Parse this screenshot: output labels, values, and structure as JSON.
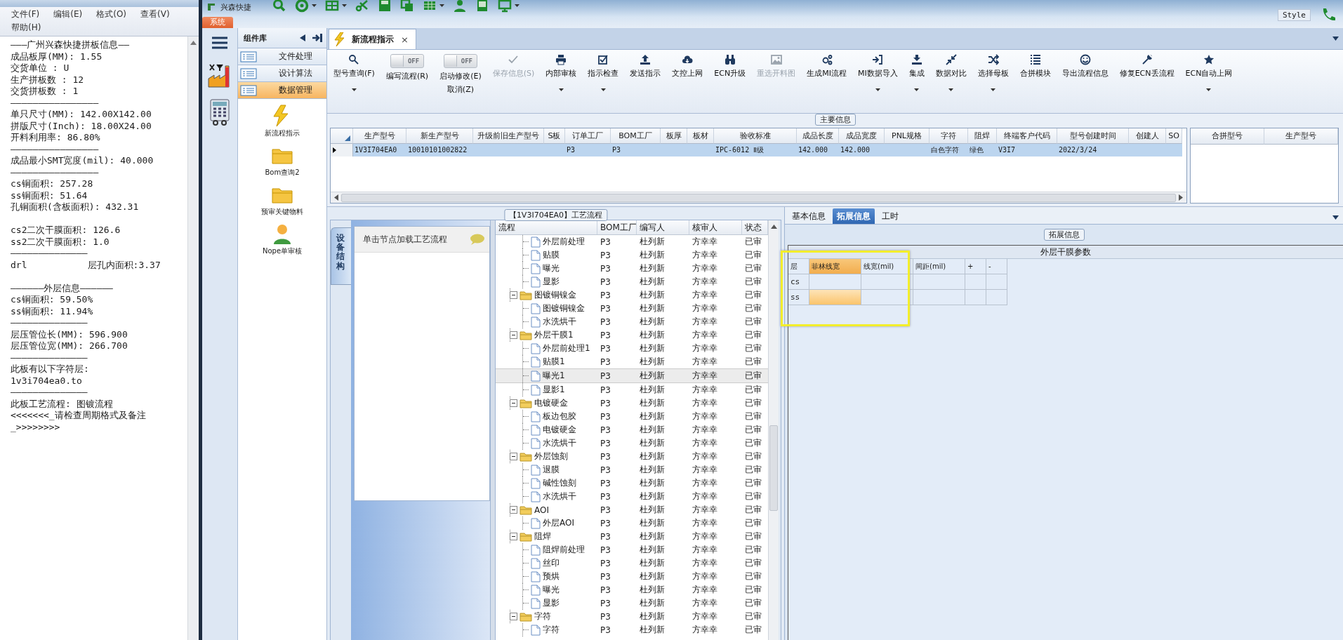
{
  "notepad": {
    "menu": [
      "文件(F)",
      "编辑(E)",
      "格式(O)",
      "查看(V)",
      "帮助(H)"
    ],
    "lines": [
      {
        "text": "———广州兴森快捷拼板信息——"
      },
      {
        "text": "成品板厚(MM): 1.55"
      },
      {
        "text": "交货单位 : U"
      },
      {
        "text": "生产拼板数 : 12"
      },
      {
        "text": "交货拼板数 : 1"
      },
      {
        "text": "————————————————"
      },
      {
        "text": "单只尺寸(MM): 142.00X142.00"
      },
      {
        "text": "拼版尺寸(Inch): 18.00X24.00"
      },
      {
        "text": "开料利用率: 86.80%"
      },
      {
        "text": "————————————————"
      },
      {
        "text": "成品最小SMT宽度(mil): 40.000"
      },
      {
        "text": "————————————————"
      },
      {
        "text": "cs铜面积: 257.28"
      },
      {
        "text": "ss铜面积: 51.64"
      },
      {
        "text": "孔铜面积(含板面积): 432.31"
      },
      {
        "kind": "blank"
      },
      {
        "text": "cs2二次干膜面积: 126.6"
      },
      {
        "text": "ss2二次干膜面积: 1.0"
      },
      {
        "text": "——————————————"
      },
      {
        "text": "drl           层孔内面积:3.37"
      },
      {
        "kind": "blank"
      },
      {
        "text": "——————外层信息——————"
      },
      {
        "text": "cs铜面积: 59.50%"
      },
      {
        "text": "ss铜面积: 11.94%"
      },
      {
        "text": "——————————————"
      },
      {
        "text": "层压管位长(MM): 596.900"
      },
      {
        "text": "层压管位宽(MM): 266.700"
      },
      {
        "text": "——————————————"
      },
      {
        "text": "此板有以下字符层:"
      },
      {
        "text": "1v3i704ea0.to"
      },
      {
        "text": "——————————————"
      },
      {
        "text": "此板工艺流程: 图镀流程"
      },
      {
        "text": "<<<<<<<_请检查周期格式及备注"
      },
      {
        "text": "_>>>>>>>>"
      }
    ]
  },
  "app": {
    "title": "兴森快捷",
    "system_tab": "系统",
    "style_label": "Style"
  },
  "component_library": {
    "title": "组件库",
    "categories": [
      {
        "label": "文件处理",
        "selected": false
      },
      {
        "label": "设计算法",
        "selected": false
      },
      {
        "label": "数据管理",
        "selected": true
      }
    ],
    "items": [
      {
        "label": "新流程指示"
      },
      {
        "label": "Bom查询2"
      },
      {
        "label": "预审关键物料"
      },
      {
        "label": "Nope单审核"
      }
    ]
  },
  "document_tabs": [
    {
      "label": "新流程指示",
      "close": "×",
      "selected": true
    }
  ],
  "ribbon": [
    {
      "kind": "button",
      "label": "型号查询(F)",
      "dropdown": true,
      "disabled": false
    },
    {
      "kind": "toggle",
      "toggle_text": "OFF",
      "on": false,
      "label": "编写流程(R)",
      "dropdown": false,
      "disabled": false
    },
    {
      "kind": "toggle",
      "toggle_text": "OFF",
      "on": false,
      "label": "启动修改(E)",
      "label2": "取消(Z)",
      "dropdown": false,
      "disabled": false
    },
    {
      "kind": "button",
      "label": "保存信息(S)",
      "dropdown": false,
      "disabled": true
    },
    {
      "kind": "button",
      "label": "内部审核",
      "dropdown": true,
      "disabled": false
    },
    {
      "kind": "button",
      "label": "指示检查",
      "dropdown": true,
      "disabled": false
    },
    {
      "kind": "button",
      "label": "发送指示",
      "dropdown": false,
      "disabled": false
    },
    {
      "kind": "button",
      "label": "文控上网",
      "dropdown": false,
      "disabled": false
    },
    {
      "kind": "button",
      "label": "ECN升级",
      "dropdown": false,
      "disabled": false
    },
    {
      "kind": "button",
      "label": "重选开料图",
      "dropdown": false,
      "disabled": true
    },
    {
      "kind": "button",
      "label": "生成MI流程",
      "dropdown": false,
      "disabled": false
    },
    {
      "kind": "button",
      "label": "MI数据导入",
      "dropdown": true,
      "disabled": false
    },
    {
      "kind": "button",
      "label": "集成",
      "dropdown": true,
      "disabled": false
    },
    {
      "kind": "button",
      "label": "数据对比",
      "dropdown": true,
      "disabled": false
    },
    {
      "kind": "button",
      "label": "选择母板",
      "dropdown": true,
      "disabled": false
    },
    {
      "kind": "button",
      "label": "合拼模块",
      "dropdown": false,
      "disabled": false
    },
    {
      "kind": "button",
      "label": "导出流程信息",
      "dropdown": false,
      "disabled": false
    },
    {
      "kind": "button",
      "label": "修复ECN丢流程",
      "dropdown": false,
      "disabled": false
    },
    {
      "kind": "button",
      "label": "ECN自动上网",
      "dropdown": true,
      "disabled": false
    }
  ],
  "main_info": {
    "title": "主要信息",
    "columns": [
      "生产型号",
      "新生产型号",
      "升级前旧生产型号",
      "S板",
      "订单工厂",
      "BOM工厂",
      "板厚",
      "板材",
      "验收标准",
      "成品长度",
      "成品宽度",
      "PNL规格",
      "字符",
      "阻焊",
      "终端客户代码",
      "型号创建时间",
      "创建人",
      "SO"
    ],
    "rows": [
      {
        "selected": true,
        "cells": [
          "1V3I704EA0",
          "10010101002822",
          null,
          null,
          "P3",
          "P3",
          null,
          null,
          "IPC-6012 Ⅱ级",
          "142.000",
          "142.000",
          null,
          "白色字符",
          "绿色",
          "V3I7",
          "2022/3/24",
          null,
          null
        ]
      }
    ],
    "side_columns": [
      "合拼型号",
      "生产型号"
    ]
  },
  "process_flow": {
    "title": "【1V3I704EA0】工艺流程",
    "side_tab": "设备结构",
    "hint": "单击节点加载工艺流程",
    "columns": [
      "流程",
      "BOM工厂",
      "编写人",
      "核审人",
      "状态"
    ],
    "tree": [
      {
        "kind": "continued",
        "children": [
          {
            "kind": "step",
            "label": "外层前处理",
            "bom": "P3",
            "writer": "杜列新",
            "reviewer": "方幸幸",
            "status": "已审",
            "selected": false
          },
          {
            "kind": "step",
            "label": "贴膜",
            "bom": "P3",
            "writer": "杜列新",
            "reviewer": "方幸幸",
            "status": "已审",
            "selected": false
          },
          {
            "kind": "step",
            "label": "曝光",
            "bom": "P3",
            "writer": "杜列新",
            "reviewer": "方幸幸",
            "status": "已审",
            "selected": false
          },
          {
            "kind": "step",
            "label": "显影",
            "bom": "P3",
            "writer": "杜列新",
            "reviewer": "方幸幸",
            "status": "已审",
            "selected": false
          }
        ]
      },
      {
        "kind": "group",
        "label": "图镀铜镍金",
        "bom": "P3",
        "writer": "杜列新",
        "reviewer": "方幸幸",
        "status": "已审",
        "selected": false,
        "expanded": true,
        "children": [
          {
            "kind": "step",
            "label": "图镀铜镍金",
            "bom": "P3",
            "writer": "杜列新",
            "reviewer": "方幸幸",
            "status": "已审",
            "selected": false
          },
          {
            "kind": "step",
            "label": "水洗烘干",
            "bom": "P3",
            "writer": "杜列新",
            "reviewer": "方幸幸",
            "status": "已审",
            "selected": false
          }
        ]
      },
      {
        "kind": "group",
        "label": "外层干膜1",
        "bom": "P3",
        "writer": "杜列新",
        "reviewer": "方幸幸",
        "status": "已审",
        "selected": false,
        "expanded": true,
        "children": [
          {
            "kind": "step",
            "label": "外层前处理1",
            "bom": "P3",
            "writer": "杜列新",
            "reviewer": "方幸幸",
            "status": "已审",
            "selected": false
          },
          {
            "kind": "step",
            "label": "贴膜1",
            "bom": "P3",
            "writer": "杜列新",
            "reviewer": "方幸幸",
            "status": "已审",
            "selected": false
          },
          {
            "kind": "step",
            "label": "曝光1",
            "bom": "P3",
            "writer": "杜列新",
            "reviewer": "方幸幸",
            "status": "已审",
            "selected": true
          },
          {
            "kind": "step",
            "label": "显影1",
            "bom": "P3",
            "writer": "杜列新",
            "reviewer": "方幸幸",
            "status": "已审",
            "selected": false
          }
        ]
      },
      {
        "kind": "group",
        "label": "电镀硬金",
        "bom": "P3",
        "writer": "杜列新",
        "reviewer": "方幸幸",
        "status": "已审",
        "selected": false,
        "expanded": true,
        "children": [
          {
            "kind": "step",
            "label": "板边包胶",
            "bom": "P3",
            "writer": "杜列新",
            "reviewer": "方幸幸",
            "status": "已审",
            "selected": false
          },
          {
            "kind": "step",
            "label": "电镀硬金",
            "bom": "P3",
            "writer": "杜列新",
            "reviewer": "方幸幸",
            "status": "已审",
            "selected": false
          },
          {
            "kind": "step",
            "label": "水洗烘干",
            "bom": "P3",
            "writer": "杜列新",
            "reviewer": "方幸幸",
            "status": "已审",
            "selected": false
          }
        ]
      },
      {
        "kind": "group",
        "label": "外层蚀刻",
        "bom": "P3",
        "writer": "杜列新",
        "reviewer": "方幸幸",
        "status": "已审",
        "selected": false,
        "expanded": true,
        "children": [
          {
            "kind": "step",
            "label": "退膜",
            "bom": "P3",
            "writer": "杜列新",
            "reviewer": "方幸幸",
            "status": "已审",
            "selected": false
          },
          {
            "kind": "step",
            "label": "碱性蚀刻",
            "bom": "P3",
            "writer": "杜列新",
            "reviewer": "方幸幸",
            "status": "已审",
            "selected": false
          },
          {
            "kind": "step",
            "label": "水洗烘干",
            "bom": "P3",
            "writer": "杜列新",
            "reviewer": "方幸幸",
            "status": "已审",
            "selected": false
          }
        ]
      },
      {
        "kind": "group",
        "label": "AOI",
        "bom": "P3",
        "writer": "杜列新",
        "reviewer": "方幸幸",
        "status": "已审",
        "selected": false,
        "expanded": true,
        "children": [
          {
            "kind": "step",
            "label": "外层AOI",
            "bom": "P3",
            "writer": "杜列新",
            "reviewer": "方幸幸",
            "status": "已审",
            "selected": false
          }
        ]
      },
      {
        "kind": "group",
        "label": "阻焊",
        "bom": "P3",
        "writer": "杜列新",
        "reviewer": "方幸幸",
        "status": "已审",
        "selected": false,
        "expanded": true,
        "children": [
          {
            "kind": "step",
            "label": "阻焊前处理",
            "bom": "P3",
            "writer": "杜列新",
            "reviewer": "方幸幸",
            "status": "已审",
            "selected": false
          },
          {
            "kind": "step",
            "label": "丝印",
            "bom": "P3",
            "writer": "杜列新",
            "reviewer": "方幸幸",
            "status": "已审",
            "selected": false
          },
          {
            "kind": "step",
            "label": "预烘",
            "bom": "P3",
            "writer": "杜列新",
            "reviewer": "方幸幸",
            "status": "已审",
            "selected": false
          },
          {
            "kind": "step",
            "label": "曝光",
            "bom": "P3",
            "writer": "杜列新",
            "reviewer": "方幸幸",
            "status": "已审",
            "selected": false
          },
          {
            "kind": "step",
            "label": "显影",
            "bom": "P3",
            "writer": "杜列新",
            "reviewer": "方幸幸",
            "status": "已审",
            "selected": false
          }
        ]
      },
      {
        "kind": "group",
        "label": "字符",
        "bom": "P3",
        "writer": "杜列新",
        "reviewer": "方幸幸",
        "status": "已审",
        "selected": false,
        "expanded": true,
        "children": [
          {
            "kind": "step",
            "label": "字符",
            "bom": "P3",
            "writer": "杜列新",
            "reviewer": "方幸幸",
            "status": "已审",
            "selected": false
          }
        ]
      }
    ]
  },
  "detail_tabs": [
    {
      "label": "基本信息",
      "selected": false
    },
    {
      "label": "拓展信息",
      "selected": true
    },
    {
      "label": "工时",
      "selected": false
    }
  ],
  "extended_info": {
    "title": "拓展信息",
    "table_title": "外层干膜参数",
    "columns": [
      {
        "label": "层",
        "selected": false
      },
      {
        "label": "菲林线宽",
        "selected": true
      },
      {
        "label": "线宽(mil)",
        "selected": false
      },
      {
        "label": "间距(mil)",
        "selected": false
      },
      {
        "label": "+",
        "selected": false
      },
      {
        "label": "-",
        "selected": false
      }
    ],
    "rows": [
      {
        "layer": "cs",
        "cells": [
          {
            "selected": false
          },
          {
            "selected": false
          },
          {
            "selected": false
          },
          {
            "selected": false
          },
          {
            "selected": false
          }
        ]
      },
      {
        "layer": "ss",
        "cells": [
          {
            "selected": true
          },
          {
            "selected": false
          },
          {
            "selected": false
          },
          {
            "selected": false
          },
          {
            "selected": false
          }
        ]
      }
    ]
  }
}
